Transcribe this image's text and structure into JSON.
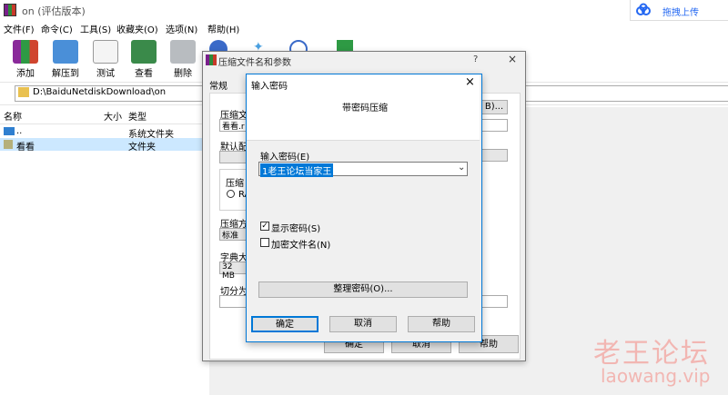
{
  "window": {
    "title": "on (评估版本)"
  },
  "menu": [
    "文件(F)",
    "命令(C)",
    "工具(S)",
    "收藏夹(O)",
    "选项(N)",
    "帮助(H)"
  ],
  "toolbar": [
    {
      "label": "添加",
      "icon": "add-archive-icon"
    },
    {
      "label": "解压到",
      "icon": "extract-to-icon"
    },
    {
      "label": "测试",
      "icon": "test-icon"
    },
    {
      "label": "查看",
      "icon": "view-icon"
    },
    {
      "label": "删除",
      "icon": "delete-icon"
    }
  ],
  "address": {
    "path": "D:\\BaiduNetdiskDownload\\on"
  },
  "columns": {
    "name": "名称",
    "size": "大小",
    "type": "类型"
  },
  "files": [
    {
      "name": "..",
      "type": "系统文件夹"
    },
    {
      "name": "看看",
      "type": "文件夹"
    }
  ],
  "cloud": {
    "label": "拖拽上传"
  },
  "archive_dialog": {
    "title": "压缩文件名和参数",
    "help": "?",
    "close": "×",
    "tab_general": "常规",
    "archive_name_label": "压缩文",
    "archive_name_value": "看看.r",
    "browse_btn": "B)...",
    "profile_label": "默认配",
    "format_label": "压缩",
    "format_opt": "RA",
    "method_label": "压缩方",
    "method_value": "标准",
    "dict_label": "字典大",
    "dict_value": "32 MB",
    "split_label": "切分为",
    "ok": "确定",
    "cancel": "取消",
    "help_btn": "帮助"
  },
  "password_dialog": {
    "title": "输入密码",
    "close": "×",
    "header": "带密码压缩",
    "enter_label": "输入密码(E)",
    "password_value": "1老王论坛当家王",
    "show_password": "显示密码(S)",
    "encrypt_names": "加密文件名(N)",
    "show_password_checked": true,
    "encrypt_names_checked": false,
    "organize_btn": "整理密码(O)...",
    "ok": "确定",
    "cancel": "取消",
    "help": "帮助"
  },
  "watermark": {
    "cn": "老王论坛",
    "en": "laowang.vip"
  }
}
